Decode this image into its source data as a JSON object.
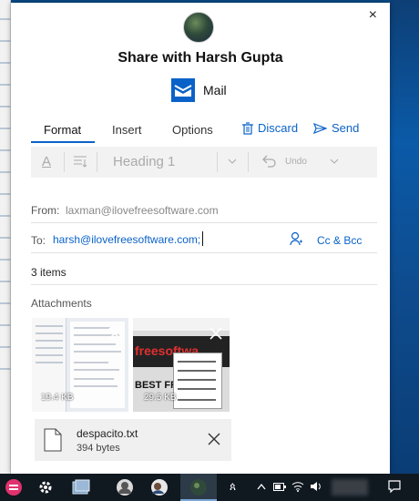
{
  "share": {
    "title": "Share with Harsh Gupta",
    "app_name": "Mail",
    "close_glyph": "×"
  },
  "tabs": {
    "format": "Format",
    "insert": "Insert",
    "options": "Options",
    "discard": "Discard",
    "send": "Send"
  },
  "toolbar": {
    "font_color_glyph": "A",
    "heading": "Heading 1",
    "undo": "Undo"
  },
  "fields": {
    "from_label": "From:",
    "from_value": "laxman@ilovefreesoftware.com",
    "to_label": "To:",
    "to_value": "harsh@ilovefreesoftware.com;",
    "cc_bcc": "Cc & Bcc",
    "items_count": "3 items",
    "attachments_label": "Attachments"
  },
  "attachments": [
    {
      "size": "19.4 KB"
    },
    {
      "size": "29.5 KB",
      "thumb_text": "freesoftwa",
      "thumb_text2": "BEST FREE"
    }
  ],
  "file": {
    "name": "despacito.txt",
    "size": "394 bytes"
  },
  "colors": {
    "accent": "#0a62c9",
    "taskbar": "#101820"
  },
  "taskbar": {
    "icons": [
      "app-icon",
      "settings-icon",
      "photos-icon",
      "user-icon",
      "contact-icon",
      "mail-icon"
    ],
    "tray_people_glyph": "ጰ"
  }
}
